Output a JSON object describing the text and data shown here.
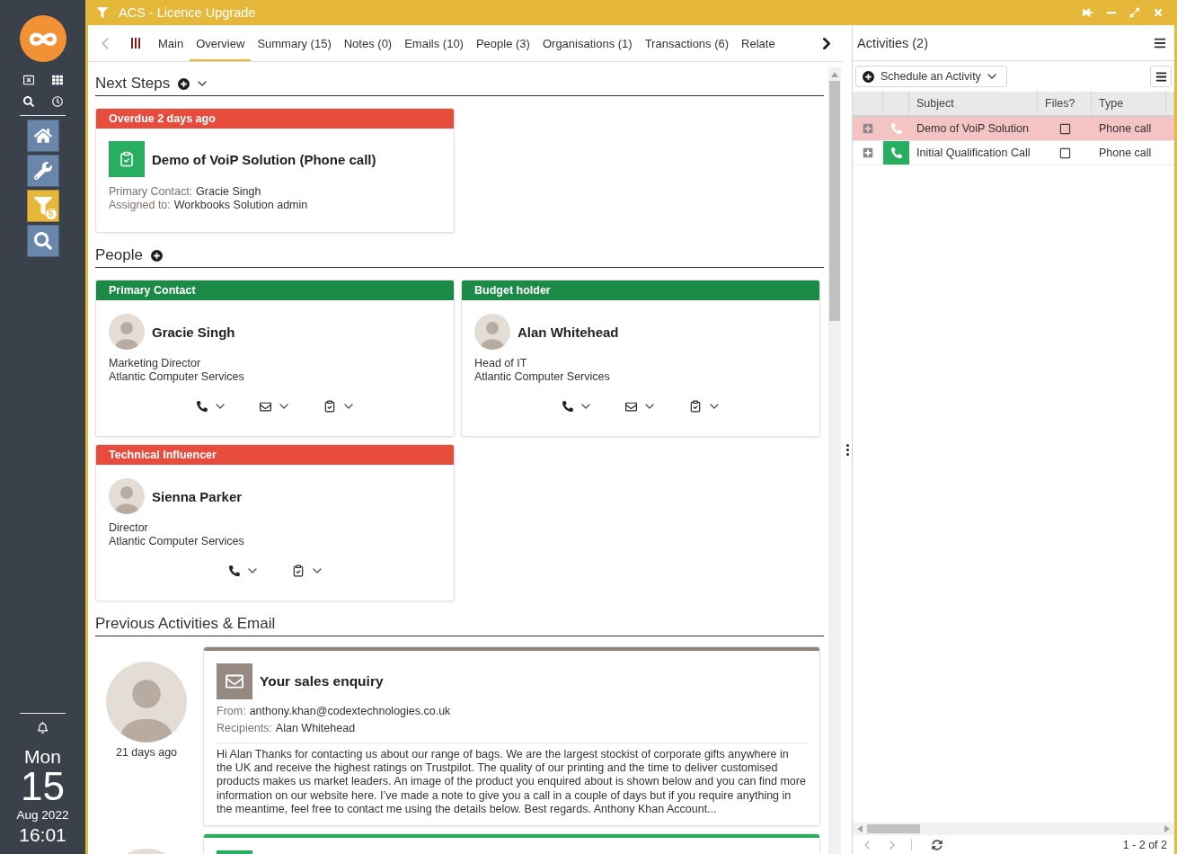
{
  "sidebar": {
    "shortcuts": [
      {
        "kind": "close-box"
      },
      {
        "kind": "grid"
      },
      {
        "kind": "search"
      },
      {
        "kind": "clock"
      }
    ],
    "nav": [
      {
        "kind": "home",
        "selected": false
      },
      {
        "kind": "tools",
        "selected": false
      },
      {
        "kind": "filter",
        "selected": true,
        "badge": "5"
      },
      {
        "kind": "search",
        "selected": false
      }
    ],
    "clock": {
      "weekday": "Mon",
      "day": "15",
      "month_year": "Aug 2022",
      "time": "16:01"
    }
  },
  "window": {
    "title": "ACS - Licence Upgrade"
  },
  "tab_scroller": {
    "back_disabled": true,
    "forward_disabled": false
  },
  "tabs": [
    {
      "label": "Main",
      "selected": false
    },
    {
      "label": "Overview",
      "selected": true
    },
    {
      "label": "Summary (15)",
      "selected": false
    },
    {
      "label": "Notes (0)",
      "selected": false
    },
    {
      "label": "Emails (10)",
      "selected": false
    },
    {
      "label": "People (3)",
      "selected": false
    },
    {
      "label": "Organisations (1)",
      "selected": false
    },
    {
      "label": "Transactions (6)",
      "selected": false
    },
    {
      "label": "Relate",
      "selected": false
    }
  ],
  "next_steps": {
    "title": "Next Steps",
    "cards": [
      {
        "status": "Overdue 2 days ago",
        "overdue": true,
        "title": "Demo of VoiP Solution (Phone call)",
        "fields": [
          {
            "label": "Primary Contact:",
            "value": "Gracie Singh"
          },
          {
            "label": "Assigned to:",
            "value": "Workbooks Solution admin"
          }
        ]
      }
    ]
  },
  "people": {
    "title": "People",
    "cards": [
      {
        "role": "Primary Contact",
        "color": "#1b8a47",
        "name": "Gracie Singh",
        "job_title": "Marketing Director",
        "organisation": "Atlantic Computer Services",
        "actions": [
          {
            "kind": "phone"
          },
          {
            "kind": "email"
          },
          {
            "kind": "task"
          }
        ]
      },
      {
        "role": "Budget holder",
        "color": "#1b8a47",
        "name": "Alan Whitehead",
        "job_title": "Head of IT",
        "organisation": "Atlantic Computer Services",
        "actions": [
          {
            "kind": "phone"
          },
          {
            "kind": "email"
          },
          {
            "kind": "task"
          }
        ]
      },
      {
        "role": "Technical Influencer",
        "color": "#e74c3c",
        "name": "Sienna Parker",
        "job_title": "Director",
        "organisation": "Atlantic Computer Services",
        "actions": [
          {
            "kind": "phone"
          },
          {
            "kind": "task"
          }
        ]
      }
    ]
  },
  "previous_activities": {
    "title": "Previous Activities & Email",
    "items": [
      {
        "kind": "email",
        "when": "21 days ago",
        "subject": "Your sales enquiry",
        "fields": [
          {
            "label": "From:",
            "value": "anthony.khan@codextechnologies.co.uk"
          },
          {
            "label": "Recipients:",
            "value": "Alan Whitehead"
          }
        ],
        "preview": "Hi Alan Thanks for contacting us about our range of bags. We are the largest stockist of corporate gifts anywhere in the UK and receive the highest ratings on Trustpilot. The quality of our printing and the time to deliver customised products makes us market leaders. An image of the product you enquired about is shown below and you can find more information on our website here. I’ve made a note to give you a call in a couple of days but if you require anything in the meantime, feel free to contact me using the details below. Best regards. Anthony Khan Account..."
      },
      {
        "kind": "task"
      }
    ]
  },
  "activities_panel": {
    "title": "Activities (2)",
    "schedule_button": "Schedule an Activity",
    "columns": [
      "Subject",
      "Files?",
      "Type"
    ],
    "rows": [
      {
        "subject": "Demo of VoiP Solution",
        "files": false,
        "type": "Phone call",
        "overdue": true
      },
      {
        "subject": "Initial Qualification Call",
        "files": false,
        "type": "Phone call",
        "overdue": false
      }
    ],
    "pager": {
      "range": "1 - 2 of 2",
      "previous_disabled": true,
      "next_disabled": true
    }
  }
}
